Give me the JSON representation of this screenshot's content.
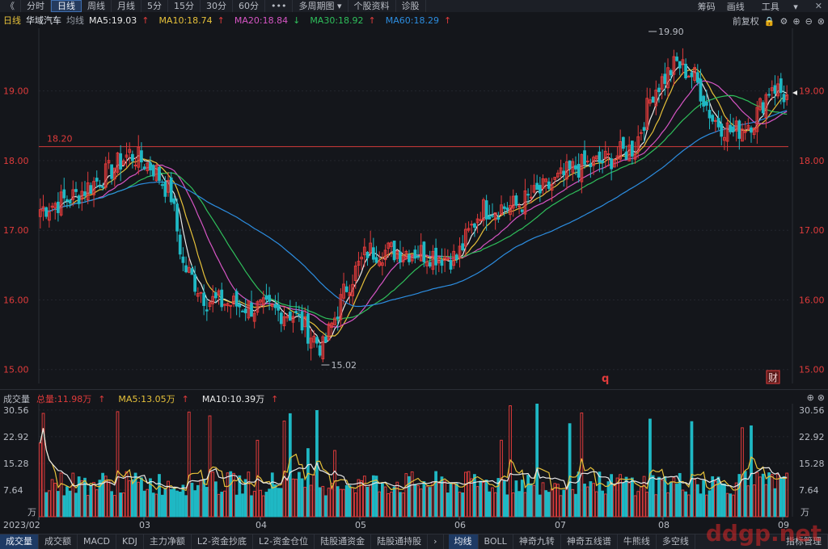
{
  "topbar": {
    "back_icon": "double-chevron-left-icon",
    "periods": [
      "分时",
      "日线",
      "周线",
      "月线",
      "5分",
      "15分",
      "30分",
      "60分"
    ],
    "active_period": "日线",
    "more_label": "•••",
    "multi_period": "多周期图",
    "stock_info": "个股资料",
    "diagnose": "诊股",
    "right": [
      "筹码",
      "画线",
      "工具"
    ]
  },
  "main_legend": {
    "chart_type": "日线",
    "name": "华域汽车",
    "ma_label": "均线",
    "ma5": "MA5:19.03",
    "ma10": "MA10:18.74",
    "ma20": "MA20:18.84",
    "ma30": "MA30:18.92",
    "ma60": "MA60:18.29",
    "adjust": "前复权"
  },
  "vol_legend": {
    "title": "成交量",
    "total": "总量:11.98万",
    "ma5": "MA5:13.05万",
    "ma10": "MA10:10.39万"
  },
  "bottombar": {
    "items": [
      "成交量",
      "成交额",
      "MACD",
      "KDJ",
      "主力净额",
      "L2-资金抄底",
      "L2-资金仓位",
      "陆股通资金",
      "陆股通持股"
    ],
    "active": "成交量",
    "arrow": "›",
    "items2": [
      "均线",
      "BOLL",
      "神奇九转",
      "神奇五线谱",
      "牛熊线",
      "多空线"
    ],
    "active2": "均线",
    "right": "指标管理"
  },
  "watermark": "ddgp.net",
  "colors": {
    "up": "#e03b3b",
    "down": "#1fb8c4",
    "ma5": "#e8e8e8",
    "ma10": "#e6c13a",
    "ma20": "#d655c4",
    "ma30": "#2fbf5b",
    "ma60": "#2c8de0",
    "hline": "#d23a3a"
  },
  "chart_data": {
    "type": "candlestick",
    "price_axis": {
      "ticks": [
        19.0,
        18.0,
        17.0,
        16.0,
        15.0
      ],
      "labels": [
        "19.00",
        "18.00",
        "17.00",
        "16.00",
        "15.00"
      ],
      "range": [
        14.8,
        19.9
      ]
    },
    "x_labels": [
      "2023/02",
      "03",
      "04",
      "05",
      "06",
      "07",
      "08",
      "09"
    ],
    "hline": {
      "value": 18.2,
      "label": "18.20"
    },
    "high_mark": {
      "value": 19.9,
      "label": "19.90"
    },
    "low_mark": {
      "value": 15.02,
      "label": "15.02"
    },
    "markers": [
      "q",
      "财"
    ],
    "volume_axis": {
      "ticks": [
        30.56,
        22.92,
        15.28,
        7.64
      ],
      "labels": [
        "30.56",
        "22.92",
        "15.28",
        "7.64"
      ],
      "unit": "万",
      "range": [
        0,
        31
      ]
    }
  }
}
